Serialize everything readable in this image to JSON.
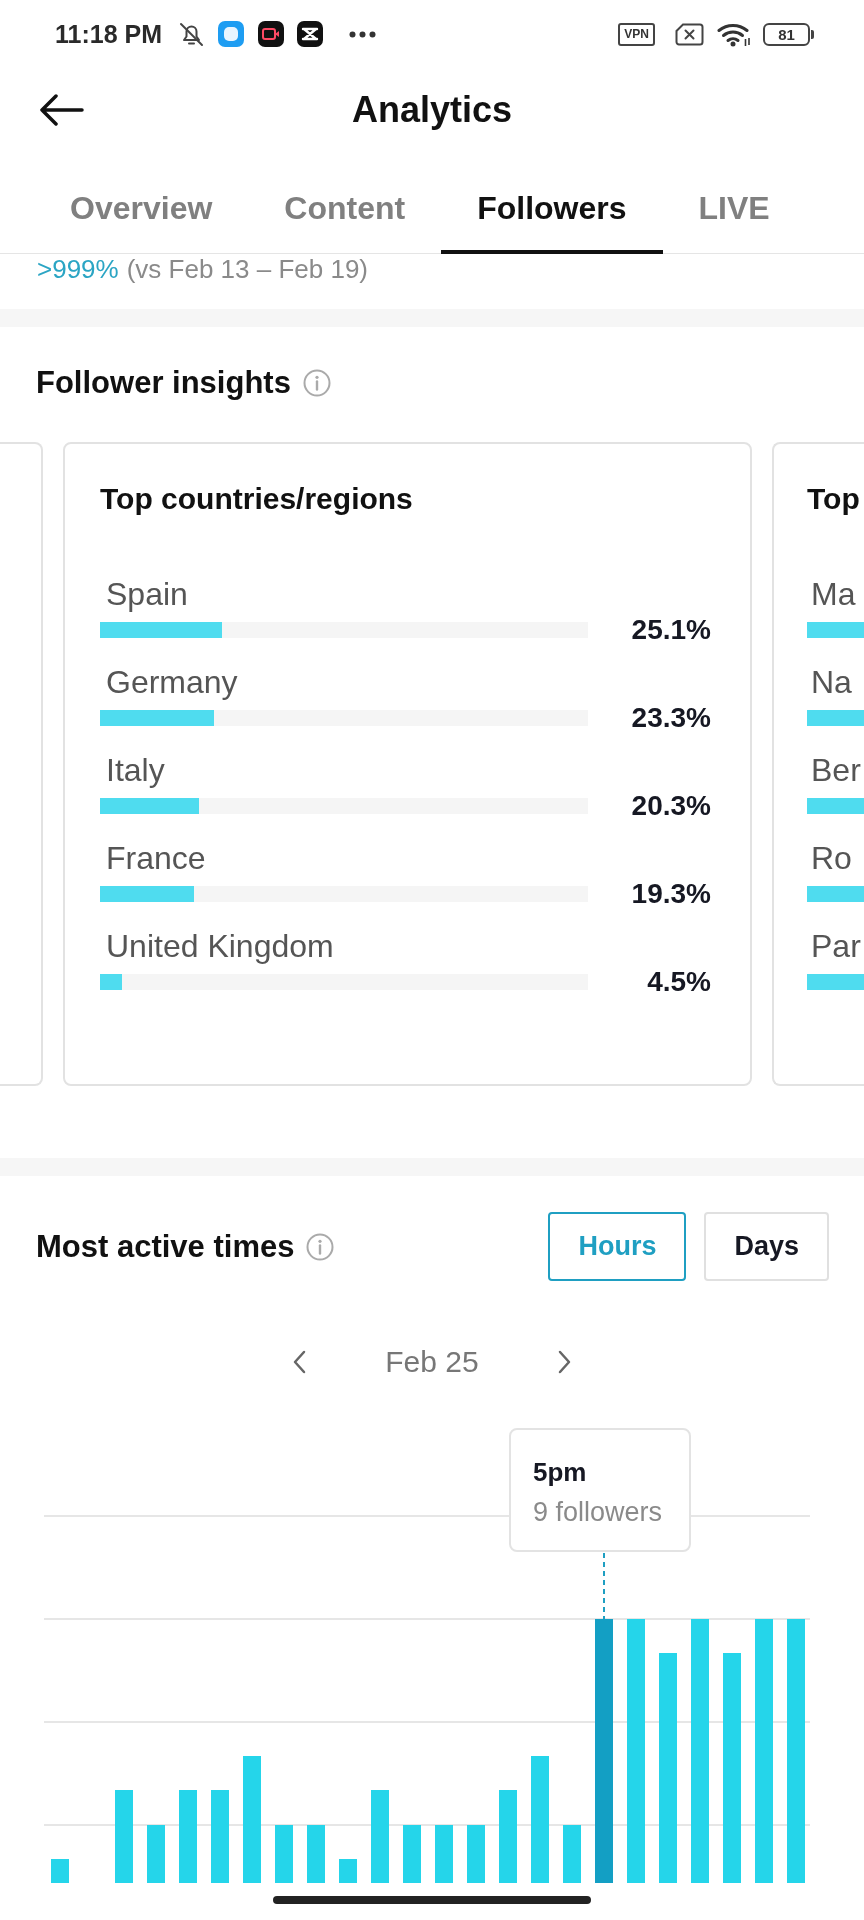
{
  "status_bar": {
    "time": "11:18 PM",
    "vpn": "VPN",
    "battery": "81"
  },
  "header": {
    "title": "Analytics"
  },
  "tabs": [
    {
      "label": "Overview",
      "selected": false
    },
    {
      "label": "Content",
      "selected": false
    },
    {
      "label": "Followers",
      "selected": true
    },
    {
      "label": "LIVE",
      "selected": false
    }
  ],
  "growth": {
    "change": ">999%",
    "comparison": "(vs Feb 13 – Feb 19)"
  },
  "follower_insights": {
    "title": "Follower insights",
    "cards": [
      {
        "kind": "cut_left"
      },
      {
        "kind": "full",
        "title": "Top countries/regions",
        "rows": [
          {
            "name": "Spain",
            "level": 0.251,
            "value": "25.1%"
          },
          {
            "name": "Germany",
            "level": 0.233,
            "value": "23.3%"
          },
          {
            "name": "Italy",
            "level": 0.203,
            "value": "20.3%"
          },
          {
            "name": "France",
            "level": 0.193,
            "value": "19.3%"
          },
          {
            "name": "United Kingdom",
            "level": 0.045,
            "value": "4.5%"
          }
        ]
      },
      {
        "kind": "cut_right",
        "title": "Top",
        "rows": [
          {
            "name": "Ma"
          },
          {
            "name": "Na"
          },
          {
            "name": "Ber"
          },
          {
            "name": "Ro"
          },
          {
            "name": "Par"
          }
        ]
      }
    ]
  },
  "most_active_times": {
    "title": "Most active times",
    "toggles": [
      {
        "label": "Hours",
        "selected": true
      },
      {
        "label": "Days",
        "selected": false
      }
    ],
    "date": "Feb 25",
    "tooltip": {
      "time": "5pm",
      "count": "9 followers"
    },
    "bars": [
      {
        "kind": "bar",
        "selected": false
      },
      {
        "kind": "empty"
      },
      {
        "kind": "bar",
        "selected": false
      },
      {
        "kind": "bar",
        "selected": false
      },
      {
        "kind": "bar",
        "selected": false
      },
      {
        "kind": "bar",
        "selected": false
      },
      {
        "kind": "bar",
        "selected": false
      },
      {
        "kind": "bar",
        "selected": false
      },
      {
        "kind": "bar",
        "selected": false
      },
      {
        "kind": "bar",
        "selected": false
      },
      {
        "kind": "bar",
        "selected": false
      },
      {
        "kind": "bar",
        "selected": false
      },
      {
        "kind": "bar",
        "selected": false
      },
      {
        "kind": "bar",
        "selected": false
      },
      {
        "kind": "bar",
        "selected": false
      },
      {
        "kind": "bar",
        "selected": false
      },
      {
        "kind": "bar",
        "selected": false
      },
      {
        "kind": "bar",
        "selected": true
      },
      {
        "kind": "bar",
        "selected": false
      },
      {
        "kind": "bar",
        "selected": false
      },
      {
        "kind": "bar",
        "selected": false
      },
      {
        "kind": "bar",
        "selected": false
      },
      {
        "kind": "bar",
        "selected": false
      },
      {
        "kind": "bar",
        "selected": false
      }
    ]
  }
}
